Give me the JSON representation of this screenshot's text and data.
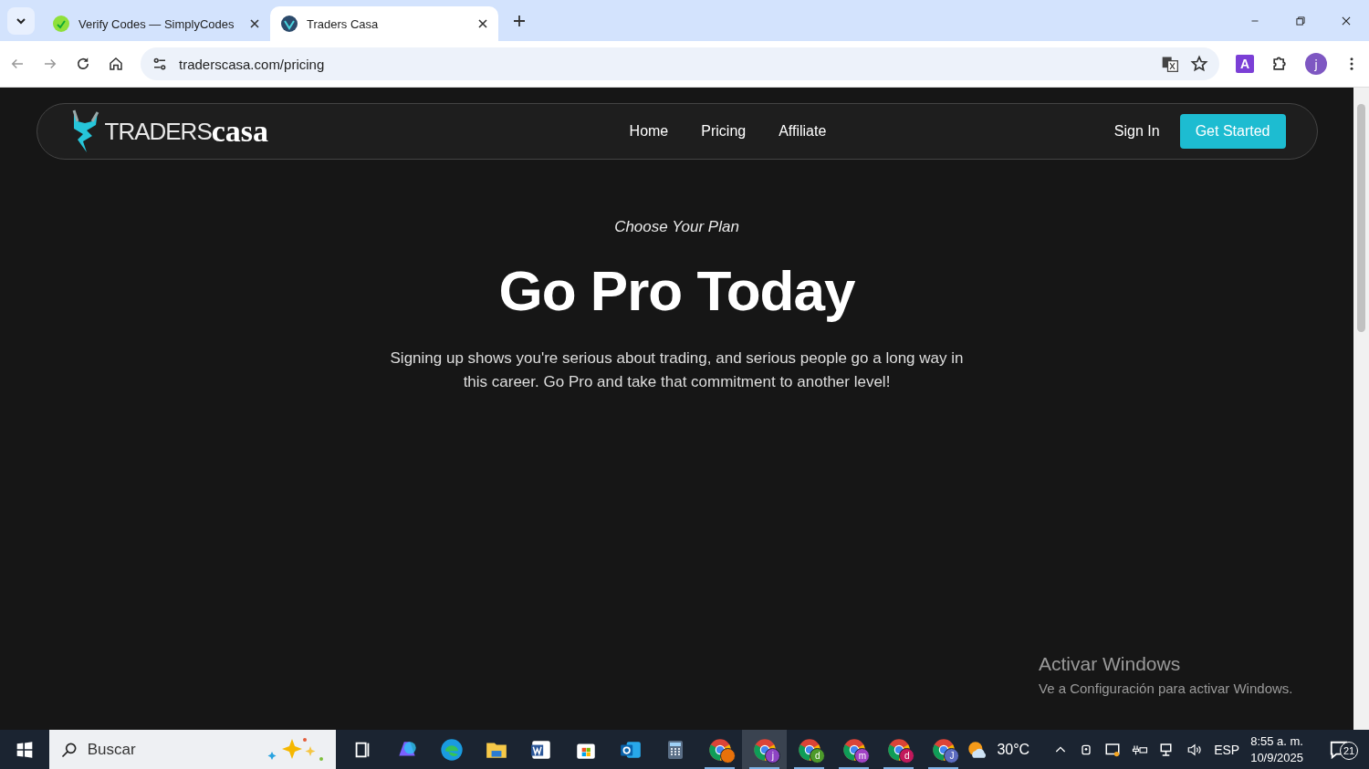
{
  "browser": {
    "tabs": [
      {
        "title": "Verify Codes — SimplyCodes",
        "selected": false
      },
      {
        "title": "Traders Casa",
        "selected": true
      }
    ],
    "address": "traderscasa.com/pricing",
    "extension_letter": "A",
    "profile_letter": "j"
  },
  "site": {
    "logo": {
      "word_1": "TRADERS",
      "word_2": "casa"
    },
    "nav": [
      {
        "label": "Home"
      },
      {
        "label": "Pricing"
      },
      {
        "label": "Affiliate"
      }
    ],
    "sign_in": "Sign In",
    "cta": "Get Started",
    "eyebrow": "Choose Your Plan",
    "headline": "Go Pro Today",
    "body": "Signing up shows you're serious about trading, and serious people go a long way in this career. Go Pro and take that commitment to another level!"
  },
  "activation": {
    "title": "Activar Windows",
    "subtitle": "Ve a Configuración para activar Windows."
  },
  "taskbar": {
    "search_placeholder": "Buscar",
    "apps": [
      {
        "kind": "taskview",
        "selected": false
      },
      {
        "kind": "copilot",
        "selected": false
      },
      {
        "kind": "edge",
        "selected": false
      },
      {
        "kind": "files",
        "selected": false
      },
      {
        "kind": "word",
        "selected": false
      },
      {
        "kind": "store",
        "selected": false
      },
      {
        "kind": "outlook",
        "selected": false
      },
      {
        "kind": "calculator",
        "selected": false
      },
      {
        "kind": "chrome",
        "color": "#e8710a",
        "selected": false
      },
      {
        "kind": "chrome",
        "badge": "j",
        "color": "#8e44c4",
        "selected": true
      },
      {
        "kind": "chrome",
        "badge": "d",
        "color": "#4c9a2a",
        "selected": false
      },
      {
        "kind": "chrome",
        "badge": "m",
        "color": "#a142c4",
        "selected": false
      },
      {
        "kind": "chrome",
        "badge": "d",
        "color": "#c2185b",
        "selected": false
      },
      {
        "kind": "chrome",
        "badge": "J",
        "color": "#5c6bc0",
        "selected": false
      }
    ],
    "weather": "30°C",
    "language": "ESP",
    "time": "8:55 a. m.",
    "date": "10/9/2025",
    "notifications": "21"
  }
}
